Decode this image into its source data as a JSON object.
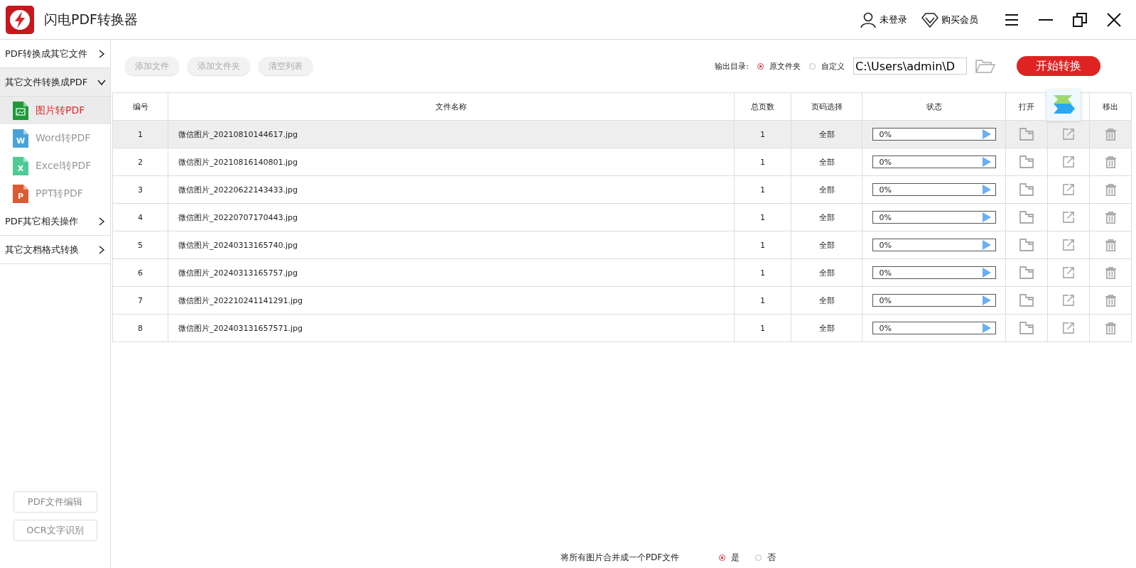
{
  "window": {
    "title": "闪电PDF转换器",
    "user": "未登录",
    "vip": "购买会员"
  },
  "sidebar": {
    "groups": [
      {
        "label": "PDF转换成其它文件",
        "expanded": false
      },
      {
        "label": "其它文件转换成PDF",
        "expanded": true,
        "items": [
          {
            "label": "图片转PDF",
            "kind": "image",
            "selected": true
          },
          {
            "label": "Word转PDF",
            "kind": "word",
            "letter": "W",
            "selected": false
          },
          {
            "label": "Excel转PDF",
            "kind": "excel",
            "letter": "X",
            "selected": false
          },
          {
            "label": "PPT转PDF",
            "kind": "ppt",
            "letter": "P",
            "selected": false
          }
        ]
      },
      {
        "label": "PDF其它相关操作",
        "expanded": false
      },
      {
        "label": "其它文档格式转换",
        "expanded": false
      }
    ],
    "buttons": [
      "PDF文件编辑",
      "OCR文字识别"
    ]
  },
  "toolbar": {
    "buttons": [
      "添加文件",
      "添加文件夹",
      "清空列表"
    ],
    "output_label": "输出目录:",
    "output_options": [
      {
        "label": "原文件夹",
        "selected": true
      },
      {
        "label": "自定义",
        "selected": false
      }
    ],
    "path": "C:\\Users\\admin\\D",
    "start": "开始转换"
  },
  "table": {
    "columns": [
      "编号",
      "文件名称",
      "总页数",
      "页码选择",
      "状态",
      "打开",
      "移出"
    ],
    "rows": [
      {
        "no": "1",
        "name": "微信图片_20210810144617.jpg",
        "pages": "1",
        "range": "全部",
        "level": 0,
        "reading": "0%",
        "selected": true
      },
      {
        "no": "2",
        "name": "微信图片_20210816140801.jpg",
        "pages": "1",
        "range": "全部",
        "level": 0,
        "reading": "0%",
        "selected": false
      },
      {
        "no": "3",
        "name": "微信图片_20220622143433.jpg",
        "pages": "1",
        "range": "全部",
        "level": 0,
        "reading": "0%",
        "selected": false
      },
      {
        "no": "4",
        "name": "微信图片_20220707170443.jpg",
        "pages": "1",
        "range": "全部",
        "level": 0,
        "reading": "0%",
        "selected": false
      },
      {
        "no": "5",
        "name": "微信图片_20240313165740.jpg",
        "pages": "1",
        "range": "全部",
        "level": 0,
        "reading": "0%",
        "selected": false
      },
      {
        "no": "6",
        "name": "微信图片_20240313165757.jpg",
        "pages": "1",
        "range": "全部",
        "level": 0,
        "reading": "0%",
        "selected": false
      },
      {
        "no": "7",
        "name": "微信图片_202210241141291.jpg",
        "pages": "1",
        "range": "全部",
        "level": 0,
        "reading": "0%",
        "selected": false
      },
      {
        "no": "8",
        "name": "微信图片_202403131657571.jpg",
        "pages": "1",
        "range": "全部",
        "level": 0,
        "reading": "0%",
        "selected": false
      }
    ]
  },
  "footer": {
    "label": "将所有图片合并成一个PDF文件",
    "options": [
      {
        "label": "是",
        "selected": true
      },
      {
        "label": "否",
        "selected": false
      }
    ]
  }
}
